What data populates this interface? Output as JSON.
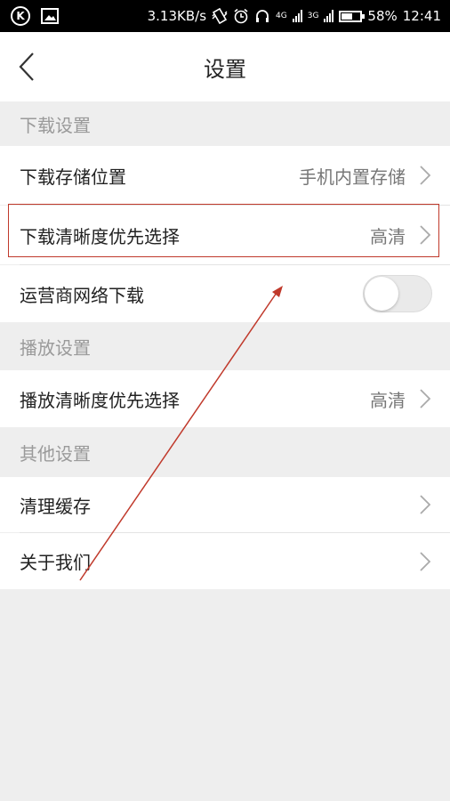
{
  "status_bar": {
    "speed": "3.13KB/s",
    "net1": "4G",
    "net2": "3G",
    "battery": "58%",
    "battery_level": 0.58,
    "time": "12:41"
  },
  "header": {
    "title": "设置"
  },
  "download_settings": {
    "header": "下载设置",
    "storage_label": "下载存储位置",
    "storage_value": "手机内置存储",
    "quality_label": "下载清晰度优先选择",
    "quality_value": "高清",
    "carrier_label": "运营商网络下载",
    "carrier_enabled": false
  },
  "play_settings": {
    "header": "播放设置",
    "quality_label": "播放清晰度优先选择",
    "quality_value": "高清"
  },
  "other_settings": {
    "header": "其他设置",
    "clear_cache_label": "清理缓存",
    "about_label": "关于我们"
  },
  "colors": {
    "annotation": "#c0392b",
    "section_bg": "#eeeeee",
    "row_bg": "#ffffff"
  }
}
